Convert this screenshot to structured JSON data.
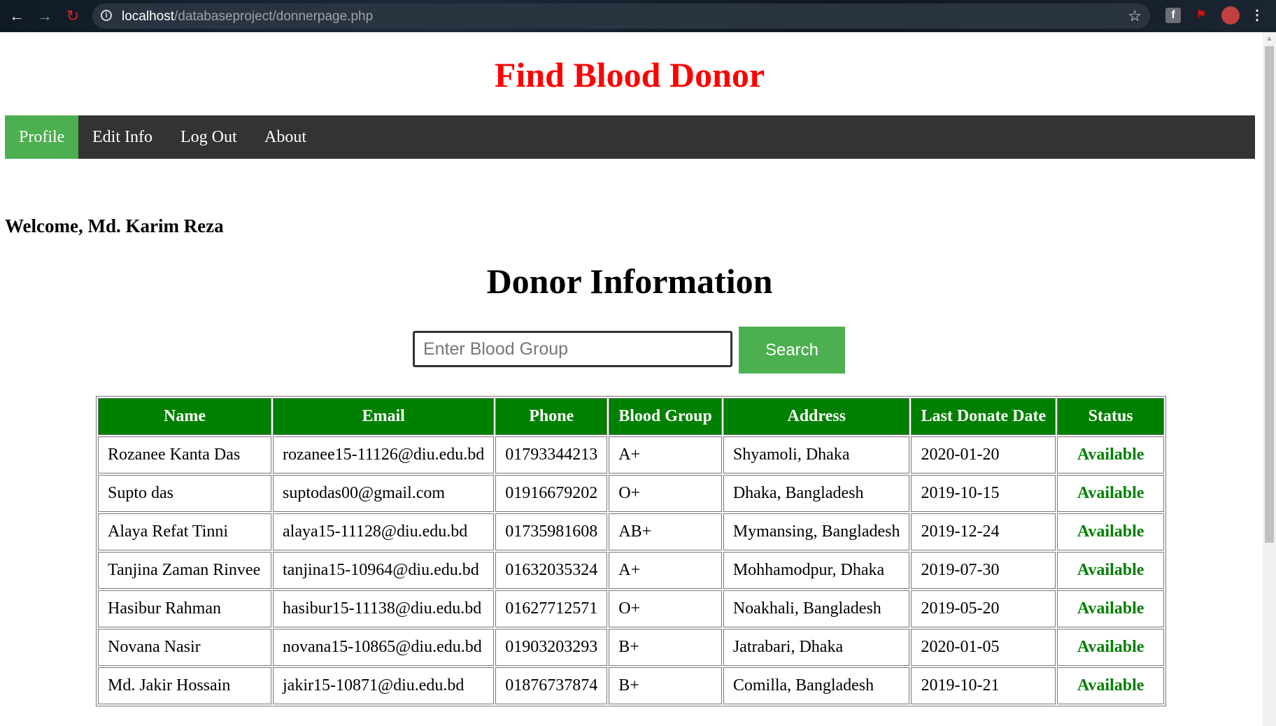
{
  "browser": {
    "url_host": "localhost",
    "url_path": "/databaseproject/donnerpage.php"
  },
  "site": {
    "title": "Find Blood Donor"
  },
  "nav": {
    "items": [
      {
        "label": "Profile"
      },
      {
        "label": "Edit Info"
      },
      {
        "label": "Log Out"
      },
      {
        "label": "About"
      }
    ]
  },
  "welcome": "Welcome, Md. Karim Reza",
  "section_title": "Donor Information",
  "search": {
    "placeholder": "Enter Blood Group",
    "button_label": "Search"
  },
  "table": {
    "headers": [
      "Name",
      "Email",
      "Phone",
      "Blood Group",
      "Address",
      "Last Donate Date",
      "Status"
    ],
    "rows": [
      [
        "Rozanee Kanta Das",
        "rozanee15-11126@diu.edu.bd",
        "01793344213",
        "A+",
        "Shyamoli, Dhaka",
        "2020-01-20",
        "Available"
      ],
      [
        "Supto das",
        "suptodas00@gmail.com",
        "01916679202",
        "O+",
        "Dhaka, Bangladesh",
        "2019-10-15",
        "Available"
      ],
      [
        "Alaya Refat Tinni",
        "alaya15-11128@diu.edu.bd",
        "01735981608",
        "AB+",
        "Mymansing, Bangladesh",
        "2019-12-24",
        "Available"
      ],
      [
        "Tanjina Zaman Rinvee",
        "tanjina15-10964@diu.edu.bd",
        "01632035324",
        "A+",
        "Mohhamodpur, Dhaka",
        "2019-07-30",
        "Available"
      ],
      [
        "Hasibur Rahman",
        "hasibur15-11138@diu.edu.bd",
        "01627712571",
        "O+",
        "Noakhali, Bangladesh",
        "2019-05-20",
        "Available"
      ],
      [
        "Novana Nasir",
        "novana15-10865@diu.edu.bd",
        "01903203293",
        "B+",
        "Jatrabari, Dhaka",
        "2020-01-05",
        "Available"
      ],
      [
        "Md. Jakir Hossain",
        "jakir15-10871@diu.edu.bd",
        "01876737874",
        "B+",
        "Comilla, Bangladesh",
        "2019-10-21",
        "Available"
      ]
    ]
  },
  "colors": {
    "title_red": "#ff0000",
    "nav_bg": "#333333",
    "nav_active": "#4caf50",
    "table_header": "#008000",
    "status_green": "#008000"
  }
}
